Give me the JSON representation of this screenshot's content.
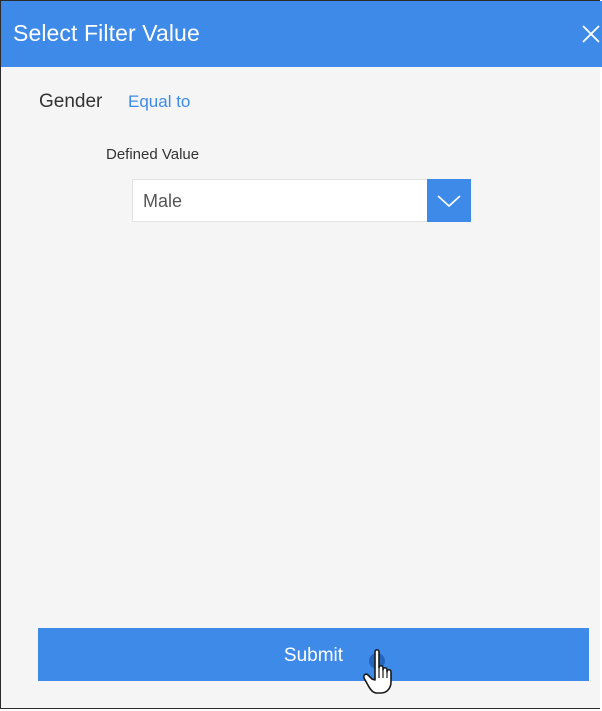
{
  "dialog": {
    "title": "Select Filter Value",
    "close_icon": "close-icon"
  },
  "filter": {
    "field": "Gender",
    "operator": "Equal to",
    "value_label": "Defined Value",
    "value": "Male",
    "dropdown_icon": "chevron-down-icon"
  },
  "actions": {
    "submit_label": "Submit"
  },
  "colors": {
    "accent": "#3e8ae8",
    "background": "#f5f5f5",
    "text": "#333333"
  },
  "cursor": {
    "type": "hand-pointer-icon"
  }
}
